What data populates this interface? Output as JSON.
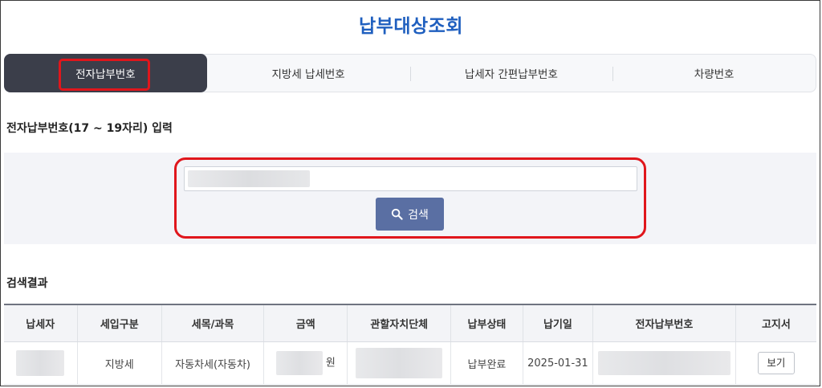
{
  "page_title": "납부대상조회",
  "tabs": [
    {
      "label": "전자납부번호",
      "active": true
    },
    {
      "label": "지방세 납세번호",
      "active": false
    },
    {
      "label": "납세자 간편납부번호",
      "active": false
    },
    {
      "label": "차량번호",
      "active": false
    }
  ],
  "input_section": {
    "label": "전자납부번호(17 ~ 19자리) 입력",
    "search_button_label": "검색"
  },
  "results": {
    "label": "검색결과",
    "columns": [
      "납세자",
      "세입구분",
      "세목/과목",
      "금액",
      "관할자치단체",
      "납부상태",
      "납기일",
      "전자납부번호",
      "고지서"
    ],
    "rows": [
      {
        "revenue_type": "지방세",
        "tax_item": "자동차세(자동차)",
        "amount_unit": "원",
        "status": "납부완료",
        "due_date": "2025-01-31",
        "view_label": "보기"
      }
    ]
  },
  "colors": {
    "title": "#1f5fbf",
    "active_tab": "#3b3e4a",
    "search_button": "#5a6fa3",
    "highlight": "#e0161c"
  }
}
